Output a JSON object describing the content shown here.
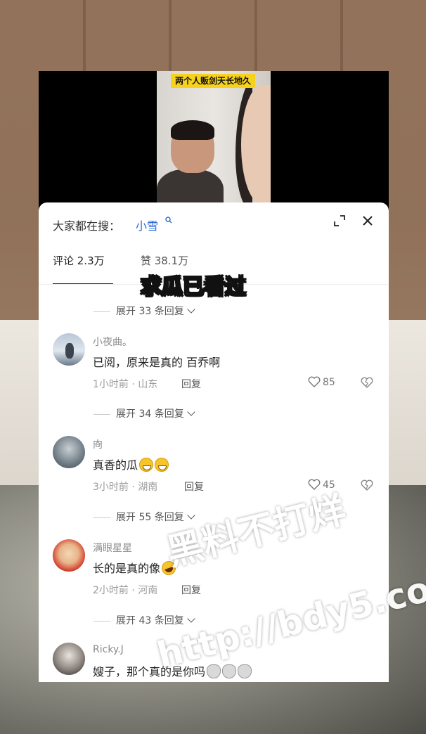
{
  "video": {
    "caption": "两个人贩剑天长地久"
  },
  "header": {
    "search_prefix": "大家都在搜：",
    "search_term": "小雪"
  },
  "tabs": [
    {
      "label": "评论 2.3万"
    },
    {
      "label": "赞 38.1万"
    }
  ],
  "overlay_caption": "求瓜已看过",
  "expand_rows": [
    {
      "label": "展开 33 条回复"
    },
    {
      "label": "展开 34 条回复"
    },
    {
      "label": "展开 55 条回复"
    },
    {
      "label": "展开 43 条回复"
    }
  ],
  "comments": [
    {
      "name": "小夜曲。",
      "text": "已阅，原来是真的  百乔啊",
      "meta": "1小时前 · 山东",
      "reply": "回复",
      "likes": "85"
    },
    {
      "name": "㕯",
      "text": "真香的瓜",
      "meta": "3小时前 · 湖南",
      "reply": "回复",
      "likes": "45"
    },
    {
      "name": "满眼星星",
      "text": "长的是真的像",
      "meta": "2小时前 · 河南",
      "reply": "回复",
      "likes": ""
    },
    {
      "name": "Ricky.J",
      "text": "嫂子，那个真的是你吗",
      "meta": "",
      "reply": "",
      "likes": ""
    }
  ],
  "watermark": {
    "line1": "黑料不打烊",
    "line2": "http://bdy5.co"
  },
  "icons": {
    "search": "search-icon",
    "expand": "expand-icon",
    "close": "close-icon",
    "like": "heart-icon",
    "dislike": "broken-heart-icon"
  },
  "colors": {
    "accent": "#2a6ad3",
    "caption_bg": "#f7d21c"
  }
}
